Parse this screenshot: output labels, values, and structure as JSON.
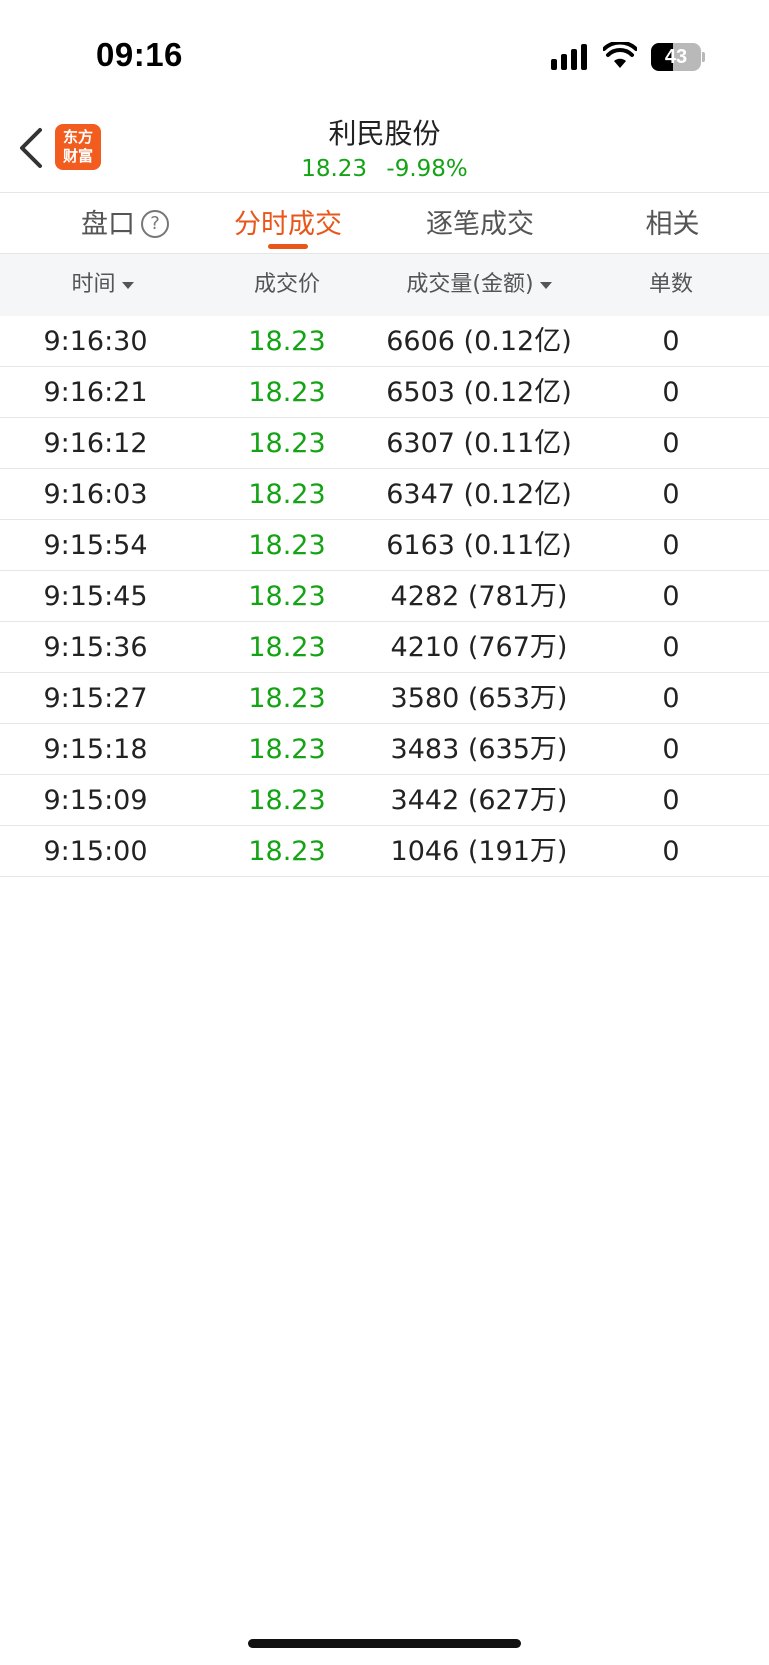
{
  "status_bar": {
    "time": "09:16",
    "battery_level": "43",
    "battery_fraction": 0.43,
    "icons": [
      "signal-icon",
      "wifi-icon",
      "battery-icon"
    ]
  },
  "header": {
    "back_icon": "chevron-left-icon",
    "logo_line1": "东方",
    "logo_line2": "财富",
    "stock_name": "利民股份",
    "price": "18.23",
    "change_pct": "-9.98%"
  },
  "tabs": [
    {
      "label": "盘口",
      "active": false
    },
    {
      "label": "分时成交",
      "active": true
    },
    {
      "label": "逐笔成交",
      "active": false
    },
    {
      "label": "相关",
      "active": false
    }
  ],
  "help_icon_glyph": "?",
  "table": {
    "headers": {
      "time": "时间",
      "price": "成交价",
      "volume": "成交量(金额)",
      "count": "单数"
    },
    "rows": [
      {
        "time": "9:16:30",
        "price": "18.23",
        "volume": "6606 (0.12亿)",
        "count": "0"
      },
      {
        "time": "9:16:21",
        "price": "18.23",
        "volume": "6503 (0.12亿)",
        "count": "0"
      },
      {
        "time": "9:16:12",
        "price": "18.23",
        "volume": "6307 (0.11亿)",
        "count": "0"
      },
      {
        "time": "9:16:03",
        "price": "18.23",
        "volume": "6347 (0.12亿)",
        "count": "0"
      },
      {
        "time": "9:15:54",
        "price": "18.23",
        "volume": "6163 (0.11亿)",
        "count": "0"
      },
      {
        "time": "9:15:45",
        "price": "18.23",
        "volume": "4282 (781万)",
        "count": "0"
      },
      {
        "time": "9:15:36",
        "price": "18.23",
        "volume": "4210 (767万)",
        "count": "0"
      },
      {
        "time": "9:15:27",
        "price": "18.23",
        "volume": "3580 (653万)",
        "count": "0"
      },
      {
        "time": "9:15:18",
        "price": "18.23",
        "volume": "3483 (635万)",
        "count": "0"
      },
      {
        "time": "9:15:09",
        "price": "18.23",
        "volume": "3442 (627万)",
        "count": "0"
      },
      {
        "time": "9:15:00",
        "price": "18.23",
        "volume": "1046 (191万)",
        "count": "0"
      }
    ]
  },
  "colors": {
    "accent": "#e8561a",
    "down": "#14a314",
    "logo_bg": "#f25c1f"
  }
}
